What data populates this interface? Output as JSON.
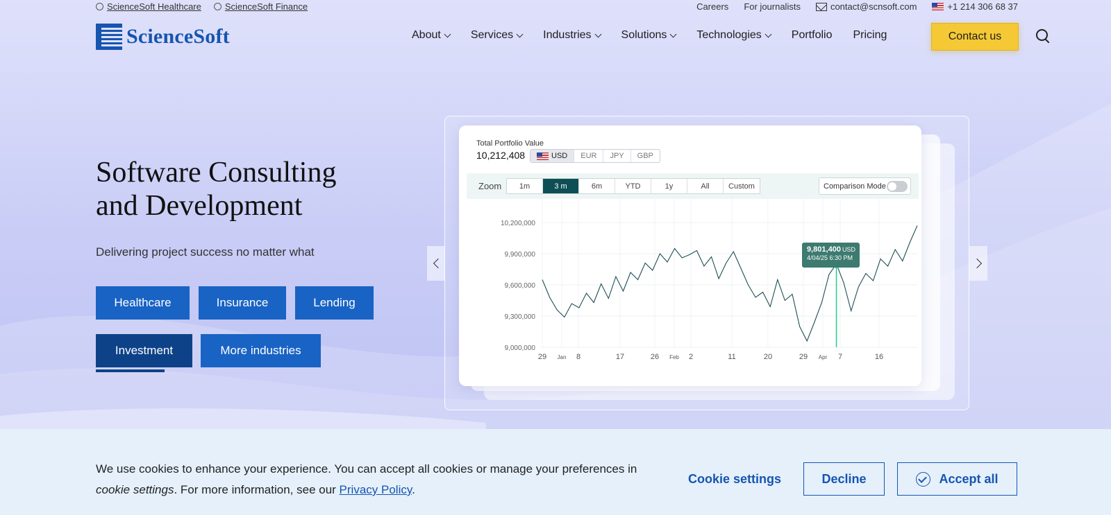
{
  "topbar": {
    "healthcare_link": "ScienceSoft Healthcare",
    "finance_link": "ScienceSoft Finance",
    "careers": "Careers",
    "journalists": "For journalists",
    "email": "contact@scnsoft.com",
    "phone": "+1 214 306 68 37"
  },
  "nav": {
    "logo_text": "ScienceSoft",
    "items": [
      "About",
      "Services",
      "Industries",
      "Solutions",
      "Technologies",
      "Portfolio",
      "Pricing"
    ],
    "contact_label": "Contact us"
  },
  "hero": {
    "title_line1": "Software Consulting",
    "title_line2": "and Development",
    "subtitle": "Delivering project success no matter what",
    "industry_buttons": [
      "Healthcare",
      "Insurance",
      "Lending",
      "Investment",
      "More industries"
    ],
    "active_button": "Investment"
  },
  "widget": {
    "portfolio_label": "Total Portfolio Value",
    "portfolio_value": "10,212,408",
    "currencies": [
      "USD",
      "EUR",
      "JPY",
      "GBP"
    ],
    "selected_currency": "USD",
    "zoom_label": "Zoom",
    "zoom_options": [
      "1m",
      "3 m",
      "6m",
      "YTD",
      "1y",
      "All",
      "Custom"
    ],
    "selected_zoom": "3 m",
    "comparison_label": "Comparison Mode",
    "comparison_on": false,
    "tooltip_value": "9,801,400",
    "tooltip_unit": "USD",
    "tooltip_date": "4/04/25  6:30 PM"
  },
  "chart_data": {
    "type": "line",
    "title": "",
    "y_ticks": [
      "10,200,000",
      "9,900,000",
      "9,600,000",
      "9,300,000",
      "9,000,000"
    ],
    "ylim": [
      9000000,
      10200000
    ],
    "x_ticks": [
      "29",
      "Jan",
      "8",
      "17",
      "26",
      "Feb",
      "2",
      "11",
      "20",
      "29",
      "Apr",
      "7",
      "16"
    ],
    "series": [
      {
        "values": [
          9650000,
          9480000,
          9360000,
          9290000,
          9420000,
          9380000,
          9520000,
          9430000,
          9610000,
          9470000,
          9680000,
          9540000,
          9720000,
          9650000,
          9810000,
          9740000,
          9900000,
          9820000,
          9950000,
          9860000,
          9890000,
          9930000,
          9780000,
          9870000,
          9660000,
          9810000,
          9920000,
          9760000,
          9600000,
          9480000,
          9530000,
          9390000,
          9650000,
          9450000,
          9510000,
          9200000,
          9060000,
          9240000,
          9430000,
          9700000,
          9801400,
          9620000,
          9350000,
          9580000,
          9710000,
          9640000,
          9850000,
          9780000,
          9940000,
          9830000,
          10010000,
          10170000
        ]
      }
    ],
    "tooltip_point": {
      "value": 9801400,
      "date": "4/04/25 6:30 PM"
    },
    "grid": true
  },
  "cookie": {
    "text_part1": "We use cookies to enhance your experience. You can accept all cookies or manage your preferences in ",
    "text_italic": "cookie settings",
    "text_part2": ". For more information, see our ",
    "privacy_link": "Privacy Policy",
    "text_end": ".",
    "settings_label": "Cookie settings",
    "decline_label": "Decline",
    "accept_label": "Accept all"
  },
  "colors": {
    "brand_blue": "#1655b0",
    "button_blue": "#1963c4",
    "button_active": "#0e4288",
    "contact_yellow": "#f5c935",
    "chart_line": "#1e4f55",
    "accent_green": "#1fd18a"
  }
}
